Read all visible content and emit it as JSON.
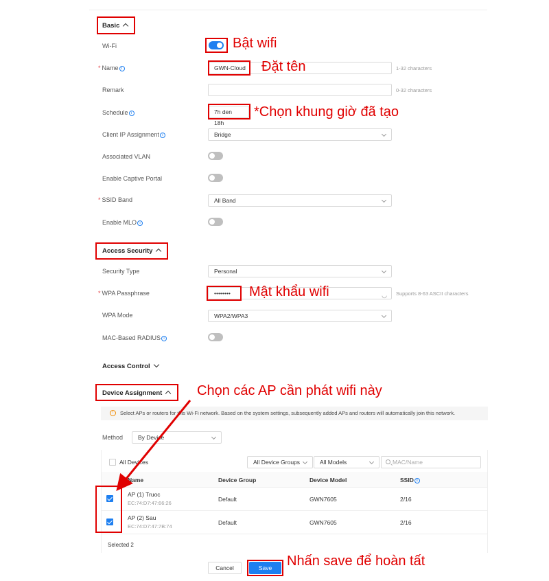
{
  "basic": {
    "title": "Basic",
    "wifi_label": "Wi-Fi",
    "name_label": "Name",
    "name_value": "GWN-Cloud",
    "name_hint": "1-32 characters",
    "remark_label": "Remark",
    "remark_value": "",
    "remark_hint": "0-32 characters",
    "schedule_label": "Schedule",
    "schedule_value": "7h den 18h",
    "client_ip_label": "Client IP Assignment",
    "client_ip_value": "Bridge",
    "vlan_label": "Associated VLAN",
    "captive_label": "Enable Captive Portal",
    "ssid_band_label": "SSID Band",
    "ssid_band_value": "All Band",
    "mlo_label": "Enable MLO"
  },
  "access_security": {
    "title": "Access Security",
    "security_type_label": "Security Type",
    "security_type_value": "Personal",
    "passphrase_label": "WPA Passphrase",
    "passphrase_value": "••••••••",
    "passphrase_hint": "Supports 8-63 ASCII characters",
    "wpa_mode_label": "WPA Mode",
    "wpa_mode_value": "WPA2/WPA3",
    "mac_radius_label": "MAC-Based RADIUS"
  },
  "access_control": {
    "title": "Access Control"
  },
  "device_assignment": {
    "title": "Device Assignment",
    "info_text": "Select APs or routers for this Wi-Fi network. Based on the system settings, subsequently added APs and routers will automatically join this network.",
    "method_label": "Method",
    "method_value": "By Device",
    "all_devices_label": "All Devices",
    "group_filter": "All Device Groups",
    "model_filter": "All Models",
    "search_placeholder": "MAC/Name",
    "columns": [
      "Name",
      "Device Group",
      "Device Model",
      "SSID"
    ],
    "rows": [
      {
        "name": "AP (1) Truoc",
        "mac": "EC:74:D7:47:66:26",
        "group": "Default",
        "model": "GWN7605",
        "ssid": "2/16"
      },
      {
        "name": "AP (2) Sau",
        "mac": "EC:74:D7:47:7B:74",
        "group": "Default",
        "model": "GWN7605",
        "ssid": "2/16"
      }
    ],
    "selected_text": "Selected 2"
  },
  "actions": {
    "cancel": "Cancel",
    "save": "Save"
  },
  "annotations": {
    "wifi": "Bật wifi",
    "name": "Đặt tên",
    "schedule": "*Chọn khung giờ đã tạo",
    "password": "Mật khẩu wifi",
    "ap": "Chọn các AP cần phát wifi này",
    "save": "Nhấn save để hoàn tất"
  },
  "colors": {
    "accent": "#1e7ff0",
    "annotation": "#e00000"
  }
}
